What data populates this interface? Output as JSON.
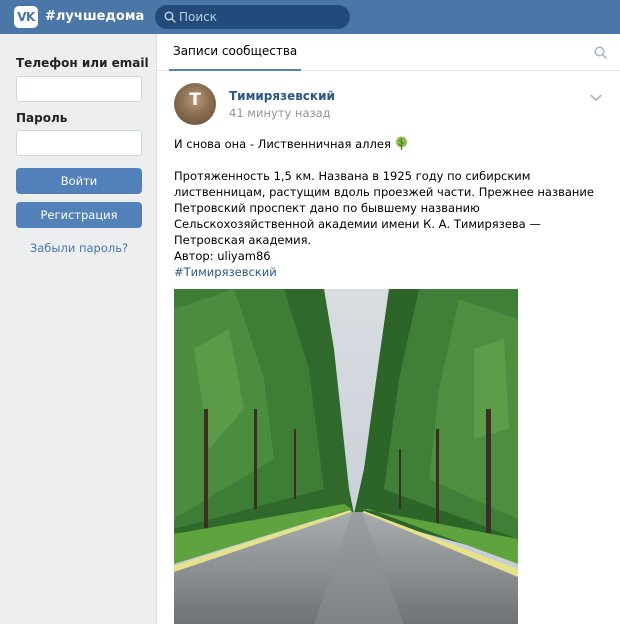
{
  "header": {
    "logo_text": "VK",
    "site_tag": "#лучшедома",
    "search_placeholder": "Поиск"
  },
  "login": {
    "login_label": "Телефон или email",
    "password_label": "Пароль",
    "login_button": "Войти",
    "register_button": "Регистрация",
    "forgot_link": "Забыли пароль?"
  },
  "feed": {
    "tab_label": "Записи сообщества",
    "post": {
      "avatar_letter": "T",
      "author": "Тимирязевский",
      "time": "41 минуту назад",
      "title": "И снова она - Лиственничная аллея",
      "body": "Протяженность 1,5 км. Названа в 1925 году по сибирским лиственницам, растущим вдоль проезжей части. Прежнее название Петровский проспект дано по бывшему названию Сельскохозяйственной академии имени К. А. Тимирязева — Петровская академия.",
      "author_credit": "Автор: uliyam86",
      "hashtag": "#Тимирязевский"
    }
  },
  "colors": {
    "header_bg": "#4a76a8",
    "button_bg": "#5181b8",
    "link": "#2a5885",
    "page_bg": "#edeef0"
  }
}
